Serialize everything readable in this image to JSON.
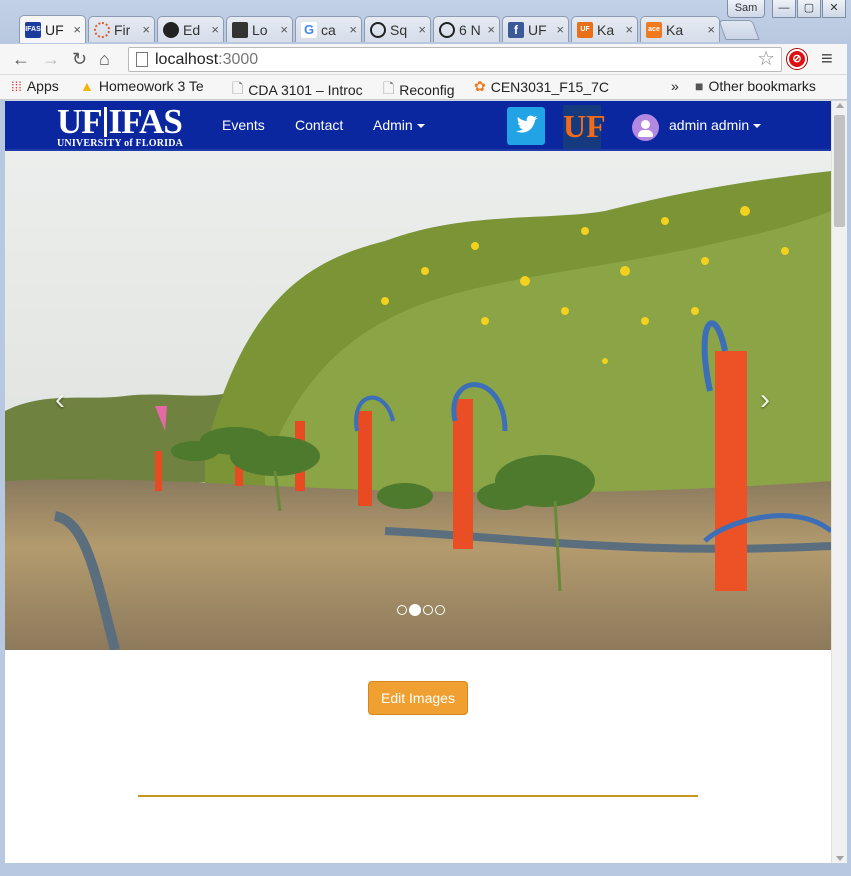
{
  "browser": {
    "tabs": [
      {
        "label": "UF",
        "favicon": "IFAS",
        "favicon_color": "#1a3c9c",
        "active": true
      },
      {
        "label": "Fir",
        "favicon": "firebase-icon",
        "favicon_color": "#e25a2a"
      },
      {
        "label": "Ed",
        "favicon": "github-icon",
        "favicon_color": "#222222"
      },
      {
        "label": "Lo",
        "favicon": "lock-icon",
        "favicon_color": "#333333"
      },
      {
        "label": "ca",
        "favicon": "G",
        "favicon_color": "#4285f4"
      },
      {
        "label": "Sq",
        "favicon": "circle-x-icon",
        "favicon_color": "#222222"
      },
      {
        "label": "6 N",
        "favicon": "circle-x-icon",
        "favicon_color": "#222222"
      },
      {
        "label": "UF",
        "favicon": "f",
        "favicon_color": "#3b5998"
      },
      {
        "label": "Ka",
        "favicon": "UF",
        "favicon_color": "#e8701a"
      },
      {
        "label": "Ka",
        "favicon": "ace",
        "favicon_color": "#f07a20"
      }
    ],
    "tab_close_glyph": "×",
    "profile_name": "Sam",
    "window_buttons": [
      "—",
      "▢",
      "✕"
    ],
    "url_host": "localhost",
    "url_port": ":3000",
    "bookmarks": [
      {
        "label": "Apps",
        "icon": "apps-grid-icon"
      },
      {
        "label": "Homeowork 3 Te",
        "icon": "drive-icon"
      },
      {
        "label": "CDA 3101 – Introc",
        "icon": "page-icon"
      },
      {
        "label": "Reconfig",
        "icon": "page-icon"
      },
      {
        "label": "CEN3031_F15_7C",
        "icon": "gear-icon"
      }
    ],
    "overflow_chevron": "»",
    "other_bookmarks": "Other bookmarks"
  },
  "site": {
    "logo_main_left": "UF",
    "logo_main_right": "IFAS",
    "logo_sub": "UNIVERSITY of FLORIDA",
    "nav": {
      "events": "Events",
      "contact": "Contact",
      "admin": "Admin"
    },
    "user_menu": "admin admin",
    "uf_badge": "UF",
    "brand_color": "#0a27a0",
    "accent_color": "#f0a030"
  },
  "carousel": {
    "prev": "‹",
    "next": "›",
    "slide_count": 4,
    "active_index": 1
  },
  "content": {
    "edit_images_label": "Edit Images"
  }
}
